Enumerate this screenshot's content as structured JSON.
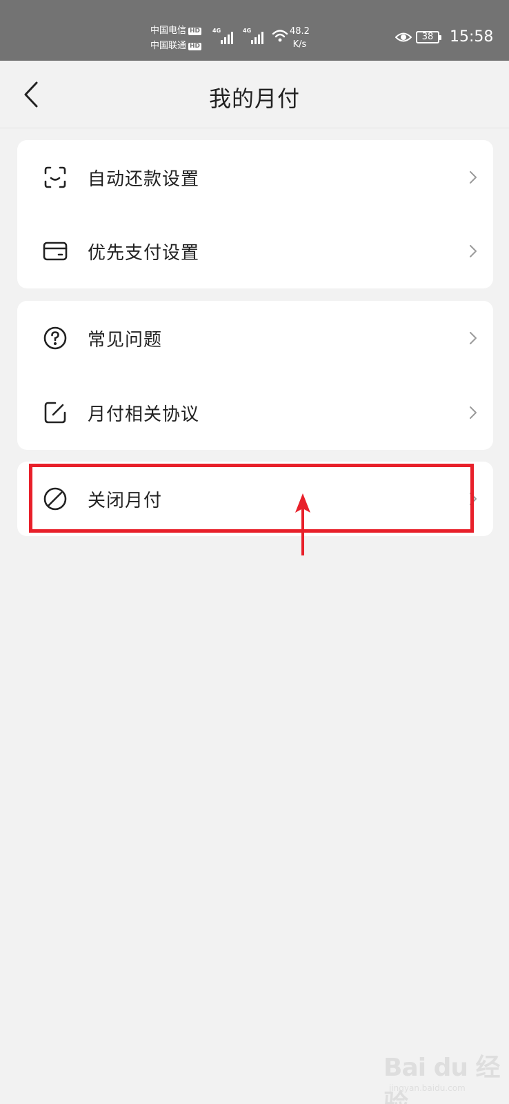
{
  "status_bar": {
    "carrier_1": "中国电信",
    "carrier_2": "中国联通",
    "hd_badge": "HD",
    "network_type": "4G",
    "speed_value": "48.2",
    "speed_unit": "K/s",
    "battery": "38",
    "time": "15:58"
  },
  "nav": {
    "title": "我的月付",
    "back_icon": "chevron-left-icon"
  },
  "menu_groups": [
    [
      {
        "label": "自动还款设置",
        "icon": "scan-face-icon"
      },
      {
        "label": "优先支付设置",
        "icon": "card-icon"
      }
    ],
    [
      {
        "label": "常见问题",
        "icon": "question-circle-icon"
      },
      {
        "label": "月付相关协议",
        "icon": "edit-square-icon"
      }
    ],
    [
      {
        "label": "关闭月付",
        "icon": "ban-circle-icon"
      }
    ]
  ],
  "annotation": {
    "highlight_color": "#e8202a",
    "target": "关闭月付"
  },
  "watermark": {
    "logo": "Bai du 经验",
    "url": "jingyan.baidu.com"
  }
}
